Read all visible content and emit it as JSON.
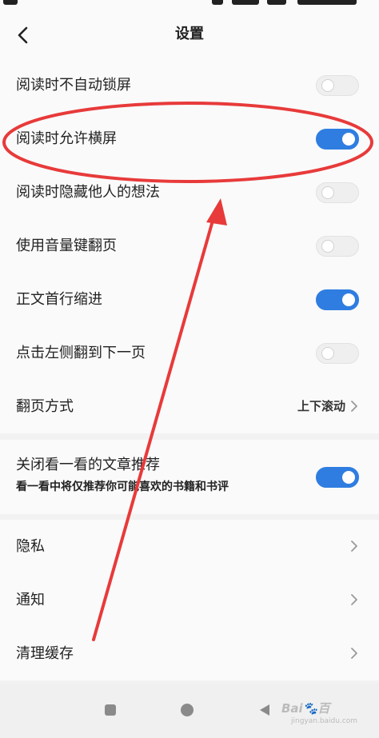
{
  "header": {
    "title": "设置"
  },
  "icons": {
    "back": "chevron-left-icon",
    "chevron": "chevron-right-icon"
  },
  "colors": {
    "accent": "#2f7de1",
    "annotation": "#e83a3a"
  },
  "section1": {
    "items": [
      {
        "label": "阅读时不自动锁屏",
        "on": false
      },
      {
        "label": "阅读时允许横屏",
        "on": true
      },
      {
        "label": "阅读时隐藏他人的想法",
        "on": false
      },
      {
        "label": "使用音量键翻页",
        "on": false
      },
      {
        "label": "正文首行缩进",
        "on": true
      },
      {
        "label": "点击左侧翻到下一页",
        "on": false
      }
    ],
    "page_mode": {
      "label": "翻页方式",
      "value": "上下滚动"
    }
  },
  "section2": {
    "label": "关闭看一看的文章推荐",
    "sub": "看一看中将仅推荐你可能喜欢的书籍和书评",
    "on": true
  },
  "section3": {
    "items": [
      {
        "label": "隐私"
      },
      {
        "label": "通知"
      },
      {
        "label": "清理缓存"
      }
    ]
  },
  "navbar": {
    "watermark": "Bai🐾百",
    "watermark_sub": "jingyan.baidu.com"
  }
}
